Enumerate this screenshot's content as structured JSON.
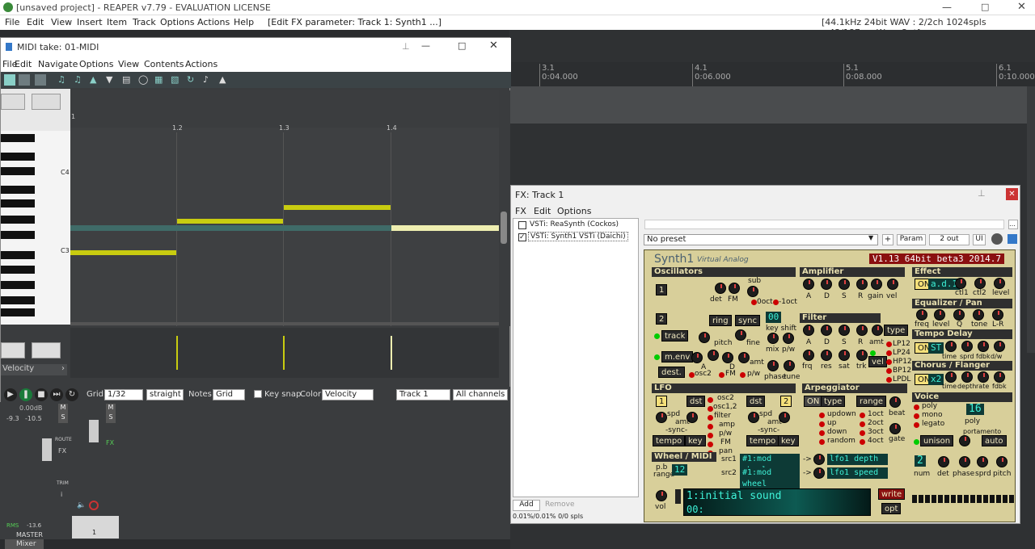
{
  "app": {
    "title": "[unsaved project] - REAPER v7.79 - EVALUATION LICENSE"
  },
  "menu": {
    "items": [
      "File",
      "Edit",
      "View",
      "Insert",
      "Item",
      "Track",
      "Options",
      "Actions",
      "Help"
    ],
    "fxparam": "[Edit FX parameter: Track 1: Synth1 ...]",
    "status": "[44.1kHz 24bit WAV : 2/2ch 1024spls ~43/187ms WaveOut]"
  },
  "ruler": {
    "marks": [
      {
        "bar": "3.1",
        "time": "0:04.000"
      },
      {
        "bar": "4.1",
        "time": "0:06.000"
      },
      {
        "bar": "5.1",
        "time": "0:08.000"
      },
      {
        "bar": "6.1",
        "time": "0:10.000"
      }
    ]
  },
  "midi": {
    "title": "MIDI take: 01-MIDI",
    "menu": [
      "File",
      "Edit",
      "Navigate",
      "Options",
      "View",
      "Contents",
      "Actions"
    ],
    "ruler": [
      "1",
      "1.2",
      "1.3",
      "1.4"
    ],
    "keys": {
      "c4": "C4",
      "c3": "C3"
    },
    "lane": "Velocity",
    "grid_label": "Grid:",
    "grid_value": "1/32",
    "swing": "straight",
    "notes_label": "Notes:",
    "notes_value": "Grid",
    "keysnap": "Key snap",
    "color_label": "Color:",
    "color_value": "Velocity",
    "track": "Track 1",
    "channels": "All channels"
  },
  "mixer": {
    "master_db": "0.00dB",
    "peak_l": "-9.3",
    "peak_r": "-10.5",
    "rms": "RMS",
    "rms_val": "-13.6",
    "master": "MASTER",
    "tab": "Mixer",
    "track_num": "1",
    "btns": {
      "m": "M",
      "s": "S",
      "route": "ROUTE",
      "fx": "FX",
      "trim": "TRIM",
      "i": "i"
    }
  },
  "fx": {
    "title": "FX: Track 1",
    "menu": [
      "FX",
      "Edit",
      "Options"
    ],
    "chain": [
      {
        "name": "VSTi: ReaSynth (Cockos)",
        "checked": false
      },
      {
        "name": "VSTi: Synth1 VSTi (Daichi)",
        "checked": true
      }
    ],
    "preset": "No preset",
    "plus": "+",
    "param": "Param",
    "out": "2 out",
    "ui": "UI",
    "add": "Add",
    "remove": "Remove",
    "cpu": "0.01%/0.01% 0/0 spls"
  },
  "synth": {
    "name": "Synth1",
    "sub": "Virtual Analog",
    "version": "V1.13 64bit beta3 2014.7",
    "sections": {
      "osc": "Oscillators",
      "amp": "Amplifier",
      "filter": "Filter",
      "lfo": "LFO",
      "arp": "Arpeggiator",
      "wheel": "Wheel / MIDI",
      "effect": "Effect",
      "eq": "Equalizer / Pan",
      "delay": "Tempo Delay",
      "chorus": "Chorus / Flanger",
      "voice": "Voice"
    },
    "labels": {
      "det": "det",
      "fm": "FM",
      "sub": "sub",
      "oct": "0oct",
      "m1oct": "-1oct",
      "ring": "ring",
      "sync": "sync",
      "track": "track",
      "pitch": "pitch",
      "fine": "fine",
      "keyshift": "key shift",
      "mix": "mix",
      "pw": "p/w",
      "menv": "m.env",
      "a": "A",
      "d": "D",
      "s": "S",
      "r": "R",
      "gain": "gain",
      "vel": "vel",
      "amt": "amt",
      "osc2": "osc2",
      "pw2": "p/w",
      "dest": "dest.",
      "phase": "phase",
      "tune": "tune",
      "frq": "frq",
      "res": "res",
      "sat": "sat",
      "trk": "trk",
      "lp12": "LP12",
      "lp24": "LP24",
      "hp12": "HP12",
      "bp12": "BP12",
      "lpdl": "LPDL",
      "on": "ON",
      "fxtype": "a.d.1",
      "ctl1": "ctl1",
      "ctl2": "ctl2",
      "level": "level",
      "freq": "freq",
      "q": "Q",
      "tone": "tone",
      "lr": "L-R",
      "st": "ST",
      "time": "time",
      "sprd": "sprd",
      "fdbk": "fdbk",
      "tonew": "tone",
      "w": "d/w",
      "x2": "x2",
      "depth": "depth",
      "rate": "rate",
      "lfodst": "dst",
      "spd": "spd",
      "sync2": "-sync-",
      "tempo": "tempo",
      "key": "key",
      "lfotargets": [
        "osc2",
        "osc1,2",
        "filter",
        "amp",
        "p/w",
        "FM",
        "pan"
      ],
      "arptype": "type",
      "range": "range",
      "beat": "beat",
      "gate": "gate",
      "updown": "updown",
      "up": "up",
      "down": "down",
      "random": "random",
      "oct1": "1oct",
      "oct2": "2oct",
      "oct3": "3oct",
      "oct4": "4oct",
      "poly": "poly",
      "mono": "mono",
      "legato": "legato",
      "voices": "16",
      "porta": "portamento",
      "unison": "unison",
      "auto": "auto",
      "num": "num",
      "unisonnum": "2",
      "detune": "det",
      "vphase": "phase",
      "vsprd": "sprd",
      "vpitch": "pitch",
      "pb": "p.b",
      "prange": "range",
      "pbval": "12",
      "src1": "src1",
      "src2": "src2",
      "src1val": "#1:mod wheel",
      "src2val": "#1:mod wheel",
      "arrow": "->",
      "dst1": "lfo1 depth",
      "dst2": "lfo1 speed",
      "vol": "vol",
      "patch": "1:initial sound",
      "bank": "00:",
      "write": "write",
      "opt": "opt",
      "oscnum1": "1",
      "oscnum2": "2",
      "shiftval": "00",
      "lfonum1": "1",
      "lfonum2": "2"
    }
  }
}
